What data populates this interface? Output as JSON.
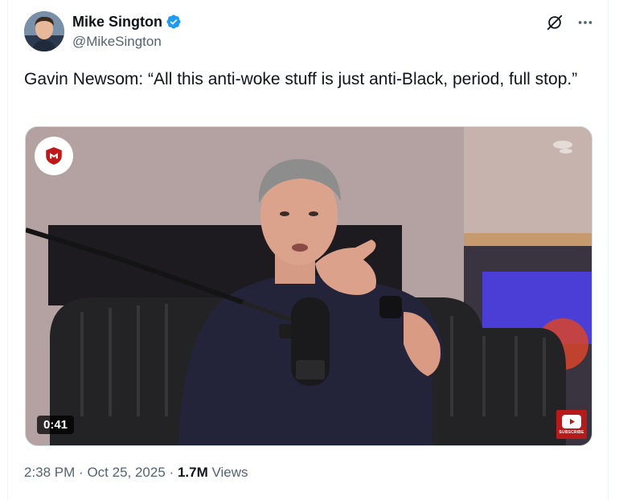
{
  "author": {
    "display_name": "Mike Sington",
    "handle": "@MikeSington",
    "verified": true
  },
  "tweet": {
    "text": "Gavin Newsom: “All this anti-woke stuff is just anti-Black, period, full stop.”"
  },
  "media": {
    "type": "video",
    "duration": "0:41",
    "overlay_logo": "mcafee-shield-logo",
    "corner_badge": "SUBSCRIBE"
  },
  "meta": {
    "time": "2:38 PM",
    "separator": "·",
    "date": "Oct 25, 2025",
    "views_count": "1.7M",
    "views_label": "Views"
  },
  "icons": {
    "grok": "grok-icon",
    "more": "more-icon"
  },
  "colors": {
    "verified_blue": "#1d9bf0",
    "text_primary": "#0f1419",
    "text_secondary": "#536471"
  }
}
